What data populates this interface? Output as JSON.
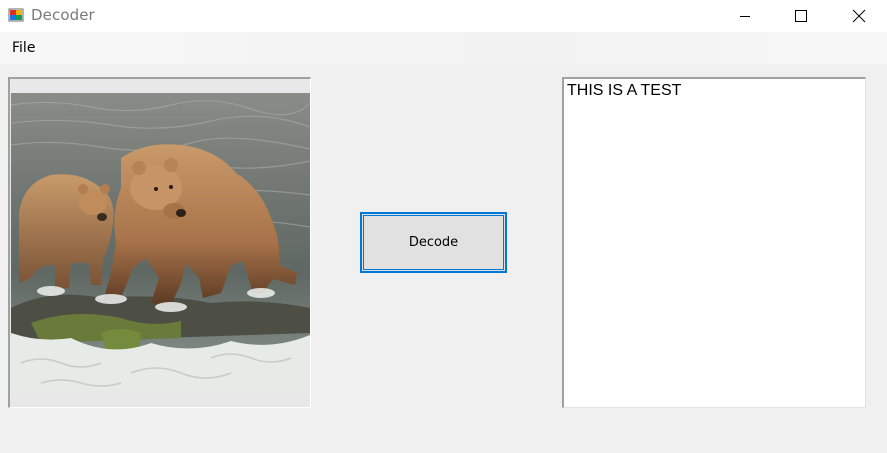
{
  "window": {
    "title": "Decoder",
    "icon": "windows-forms-app-icon",
    "controls": [
      "minimize-icon",
      "maximize-icon",
      "close-icon"
    ]
  },
  "menu": {
    "items": [
      {
        "label": "File"
      }
    ]
  },
  "picture": {
    "description_icon": "bear-photo-image"
  },
  "actions": {
    "decode_label": "Decode"
  },
  "output": {
    "text": "THIS IS A TEST"
  },
  "colors": {
    "accent": "#0078d7",
    "window_bg": "#f0f0f0",
    "titlebar_bg": "#ffffff"
  }
}
